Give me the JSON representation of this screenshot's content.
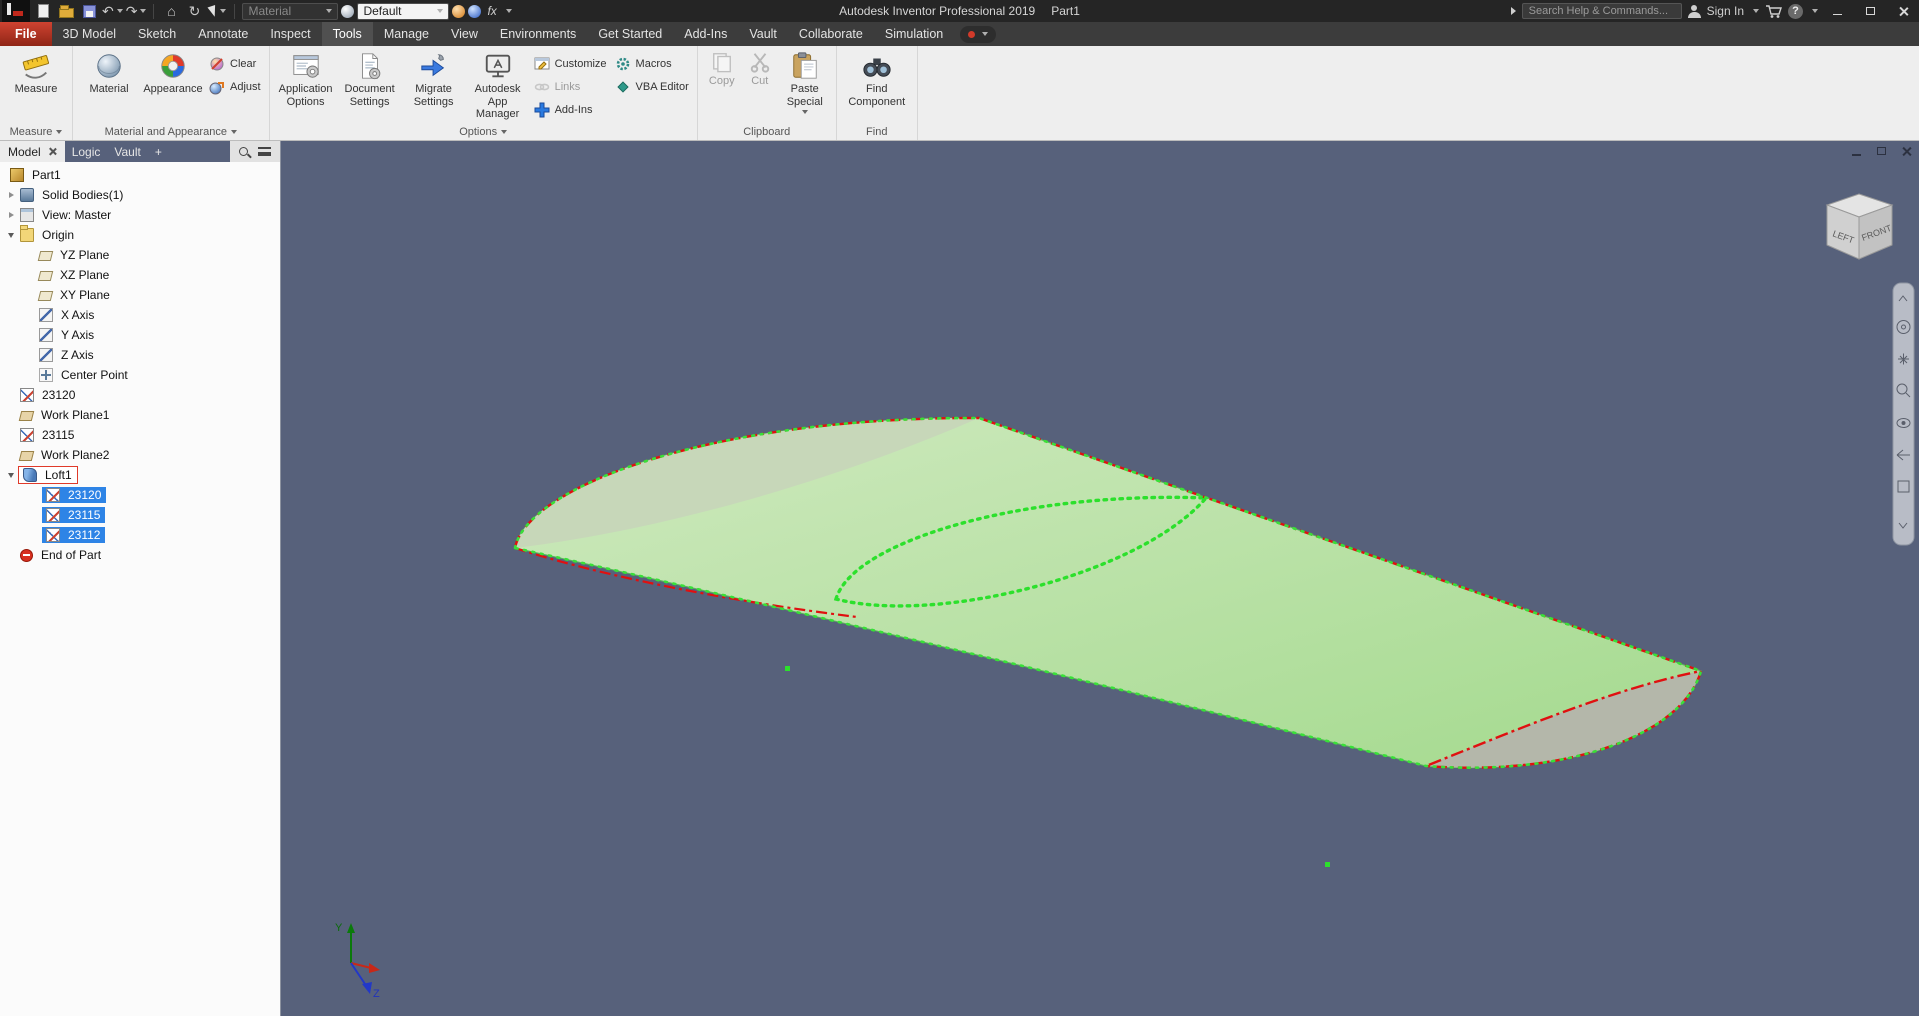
{
  "titlebar": {
    "app_title": "Autodesk Inventor Professional 2019",
    "doc_title": "Part1",
    "material_combo": "Material",
    "appearance_combo": "Default",
    "fx_label": "fx",
    "search_placeholder": "Search Help & Commands...",
    "sign_in_label": "Sign In",
    "help_glyph": "?"
  },
  "glyphs": {
    "undo": "↶",
    "redo": "↷",
    "home": "⌂",
    "update": "↻"
  },
  "ribbon_tabs": [
    {
      "label": "File"
    },
    {
      "label": "3D Model"
    },
    {
      "label": "Sketch"
    },
    {
      "label": "Annotate"
    },
    {
      "label": "Inspect"
    },
    {
      "label": "Tools"
    },
    {
      "label": "Manage"
    },
    {
      "label": "View"
    },
    {
      "label": "Environments"
    },
    {
      "label": "Get Started"
    },
    {
      "label": "Add-Ins"
    },
    {
      "label": "Vault"
    },
    {
      "label": "Collaborate"
    },
    {
      "label": "Simulation"
    }
  ],
  "ribbon": {
    "measure": {
      "footer": "Measure",
      "measure_btn": "Measure"
    },
    "material": {
      "footer": "Material and Appearance",
      "material_btn": "Material",
      "appearance_btn": "Appearance",
      "clear_btn": "Clear",
      "adjust_btn": "Adjust"
    },
    "options": {
      "footer": "Options",
      "application_options": "Application Options",
      "document_settings": "Document Settings",
      "migrate_settings": "Migrate Settings",
      "app_manager": "Autodesk App Manager",
      "customize": "Customize",
      "links": "Links",
      "add_ins": "Add-Ins",
      "macros": "Macros",
      "vba_editor": "VBA Editor"
    },
    "clipboard": {
      "footer": "Clipboard",
      "copy": "Copy",
      "cut": "Cut",
      "paste_special": "Paste Special"
    },
    "find": {
      "footer": "Find",
      "find_component": "Find Component"
    }
  },
  "browser": {
    "tabs": {
      "model": "Model",
      "logic": "Logic",
      "vault": "Vault",
      "add": "+"
    },
    "tree": [
      {
        "label": "Part1"
      },
      {
        "label": "Solid Bodies(1)"
      },
      {
        "label": "View: Master"
      },
      {
        "label": "Origin"
      },
      {
        "label": "YZ Plane"
      },
      {
        "label": "XZ Plane"
      },
      {
        "label": "XY Plane"
      },
      {
        "label": "X Axis"
      },
      {
        "label": "Y Axis"
      },
      {
        "label": "Z Axis"
      },
      {
        "label": "Center Point"
      },
      {
        "label": "23120"
      },
      {
        "label": "Work Plane1"
      },
      {
        "label": "23115"
      },
      {
        "label": "Work Plane2"
      },
      {
        "label": "Loft1"
      },
      {
        "label": "23120"
      },
      {
        "label": "23115"
      },
      {
        "label": "23112"
      },
      {
        "label": "End of Part"
      }
    ]
  },
  "viewport": {
    "viewcube": {
      "left": "LEFT",
      "front": "FRONT"
    },
    "triad": {
      "y": "Y",
      "z": "Z"
    }
  },
  "colors": {
    "selection_blue": "#2e84e6",
    "highlight_red": "#e01010",
    "profile_green": "#2ce02c",
    "viewport_bg": "#57617b"
  }
}
